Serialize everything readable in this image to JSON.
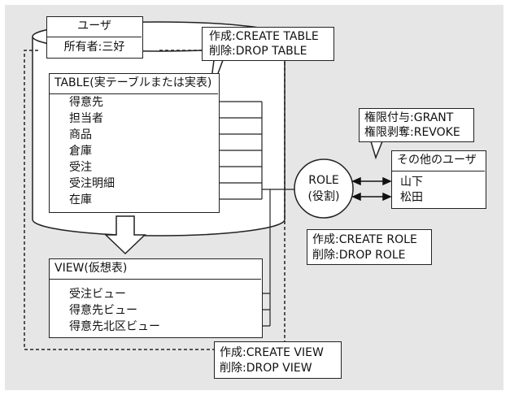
{
  "user_box": {
    "title": "ユーザ",
    "owner": "所有者:三好"
  },
  "table_callout": {
    "create": "作成:CREATE TABLE",
    "drop": "削除:DROP TABLE"
  },
  "table_box": {
    "title": "TABLE(実テーブルまたは実表)",
    "items": [
      "得意先",
      "担当者",
      "商品",
      "倉庫",
      "受注",
      "受注明細",
      "在庫"
    ]
  },
  "view_box": {
    "title": "VIEW(仮想表)",
    "items": [
      "受注ビュー",
      "得意先ビュー",
      "得意先北区ビュー"
    ]
  },
  "view_callout": {
    "create": "作成:CREATE VIEW",
    "drop": "削除:DROP VIEW"
  },
  "role": {
    "line1": "ROLE",
    "line2": "(役割)"
  },
  "role_callout": {
    "create": "作成:CREATE ROLE",
    "drop": "削除:DROP ROLE"
  },
  "grant_callout": {
    "grant": "権限付与:GRANT",
    "revoke": "権限剥奪:REVOKE"
  },
  "other_users": {
    "title": "その他のユーザ",
    "users": [
      "山下",
      "松田"
    ]
  }
}
